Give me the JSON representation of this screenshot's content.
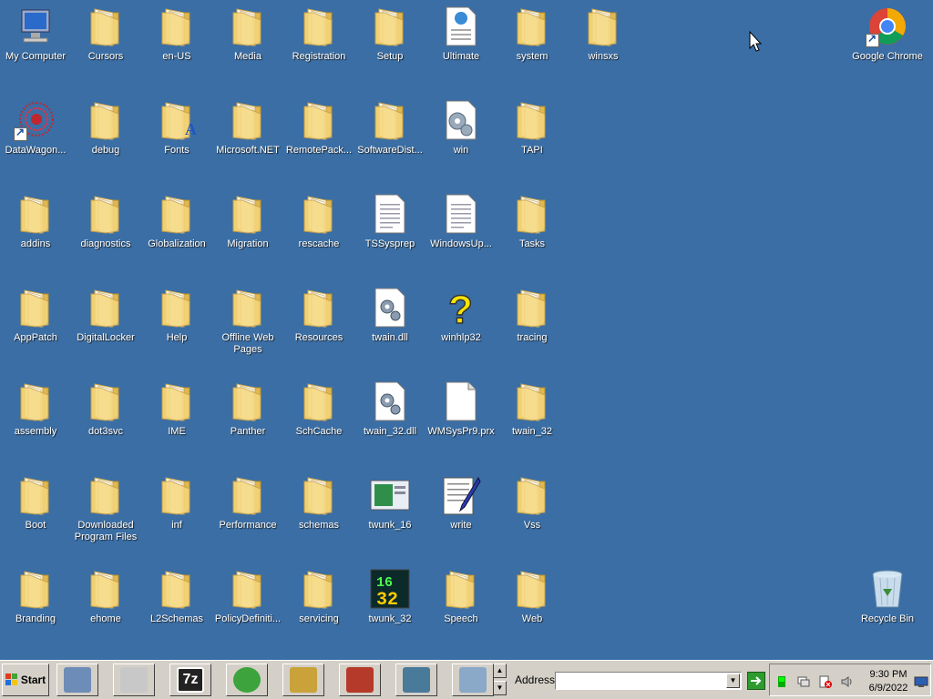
{
  "desktop": {
    "row1": [
      "My Computer",
      "Cursors",
      "en-US",
      "Media",
      "Registration",
      "Setup",
      "Ultimate",
      "system",
      "winsxs"
    ],
    "row2": [
      "DataWagon...",
      "debug",
      "Fonts",
      "Microsoft.NET",
      "RemotePack...",
      "SoftwareDist...",
      "win",
      "TAPI"
    ],
    "row3": [
      "addins",
      "diagnostics",
      "Globalization",
      "Migration",
      "rescache",
      "TSSysprep",
      "WindowsUp...",
      "Tasks"
    ],
    "row4": [
      "AppPatch",
      "DigitalLocker",
      "Help",
      "Offline Web Pages",
      "Resources",
      "twain.dll",
      "winhlp32",
      "tracing"
    ],
    "row5": [
      "assembly",
      "dot3svc",
      "IME",
      "Panther",
      "SchCache",
      "twain_32.dll",
      "WMSysPr9.prx",
      "twain_32"
    ],
    "row6": [
      "Boot",
      "Downloaded Program Files",
      "inf",
      "Performance",
      "schemas",
      "twunk_16",
      "write",
      "Vss"
    ],
    "row7": [
      "Branding",
      "ehome",
      "L2Schemas",
      "PolicyDefiniti...",
      "servicing",
      "twunk_32",
      "Speech",
      "Web"
    ],
    "chrome": "Google Chrome",
    "recycle": "Recycle Bin"
  },
  "icons": {
    "row1": [
      "computer-icon",
      "folder-icon",
      "folder-icon",
      "folder-icon",
      "folder-icon",
      "folder-icon",
      "html-file-icon",
      "folder-icon",
      "folder-icon"
    ],
    "row2": [
      "datawagon-icon",
      "folder-icon",
      "fonts-folder-icon",
      "folder-icon",
      "folder-icon",
      "folder-icon",
      "ini-file-icon",
      "folder-icon"
    ],
    "row3": [
      "folder-icon",
      "folder-icon",
      "folder-icon",
      "folder-icon",
      "folder-icon",
      "text-file-icon",
      "text-file-icon",
      "folder-icon"
    ],
    "row4": [
      "folder-icon",
      "folder-icon",
      "folder-icon",
      "folder-icon",
      "folder-icon",
      "dll-file-icon",
      "help-icon",
      "folder-icon"
    ],
    "row5": [
      "folder-icon",
      "folder-icon",
      "folder-icon",
      "folder-icon",
      "folder-icon",
      "dll-file-icon",
      "blank-file-icon",
      "folder-icon"
    ],
    "row6": [
      "folder-icon",
      "folder-icon",
      "folder-icon",
      "folder-icon",
      "folder-icon",
      "twunk16-icon",
      "write-icon",
      "folder-icon"
    ],
    "row7": [
      "folder-icon",
      "folder-icon",
      "folder-icon",
      "folder-icon",
      "folder-icon",
      "twunk32-icon",
      "folder-icon",
      "folder-icon"
    ]
  },
  "taskbar": {
    "start_label": "Start",
    "address_label": "Address",
    "address_value": "",
    "clock_time": "9:30 PM",
    "clock_date": "6/9/2022",
    "quicklaunch": [
      "network-lock-icon",
      "fax-icon",
      "7zip-icon",
      "windows-logo-icon",
      "keys-icon",
      "toolbox-icon",
      "network-card-icon",
      "disc-drive-icon"
    ]
  },
  "colors": {
    "desktop_background": "#3a6ea5",
    "folder": "#f5d67a",
    "taskbar": "#d4d0c8"
  }
}
